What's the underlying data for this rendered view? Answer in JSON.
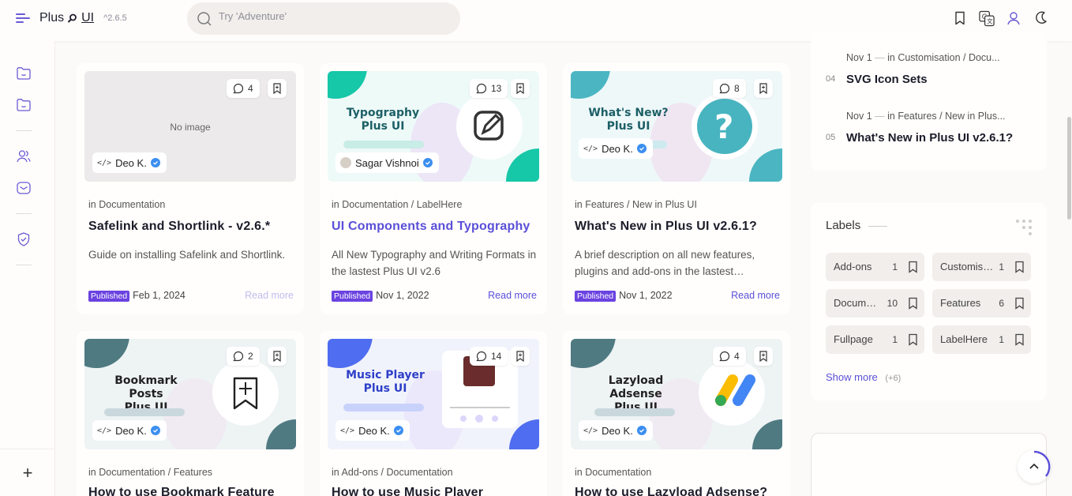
{
  "header": {
    "logo_text": "Plus",
    "logo_ui": "UI",
    "version": "^2.6.5",
    "search_placeholder": "Try 'Adventure'",
    "icons": [
      "bookmark-icon",
      "translate-icon",
      "user-icon",
      "moon-icon"
    ]
  },
  "sidebar": {
    "icons": [
      "folder-smile-icon",
      "folder-smile-icon",
      "users-icon",
      "mail-icon",
      "shield-check-icon"
    ],
    "add_label": "+"
  },
  "posts": [
    {
      "comments": "4",
      "thumb_text": "No image",
      "author": "Deo K.",
      "category": "Documentation",
      "title": "Safelink and Shortlink - v2.6.*",
      "desc": "Guide on installing Safelink and Shortlink.",
      "status": "Published",
      "date": "Feb 1, 2024",
      "read_more": "Read more"
    },
    {
      "comments": "13",
      "art_title": "Typography\nPlus UI",
      "author": "Sagar Vishnoi",
      "category": "Documentation / LabelHere",
      "title": "UI Components and Typography",
      "desc": "All New Typography and Writing Formats in the lastest Plus UI v2.6",
      "status": "Published",
      "date": "Nov 1, 2022",
      "read_more": "Read more"
    },
    {
      "comments": "8",
      "art_title": "What's New?\nPlus UI",
      "author": "Deo K.",
      "category": "Features / New in Plus UI",
      "title": "What's New in Plus UI v2.6.1?",
      "desc": "A brief description on all new features, plugins and add-ons in the lastest…",
      "status": "Published",
      "date": "Nov 1, 2022",
      "read_more": "Read more"
    },
    {
      "comments": "2",
      "art_title": "Bookmark Posts\nPlus UI",
      "author": "Deo K.",
      "category": "Documentation / Features",
      "title": "How to use Bookmark Feature"
    },
    {
      "comments": "14",
      "art_title": "Music Player\nPlus UI",
      "author": "Deo K.",
      "category": "Add-ons / Documentation",
      "title": "How to use Music Player"
    },
    {
      "comments": "4",
      "art_title": "Lazyload Adsense\nPlus UI",
      "author": "Deo K.",
      "category": "Documentation",
      "title": "How to use Lazyload Adsense?"
    }
  ],
  "popular": [
    {
      "num": "04",
      "date": "Nov 1",
      "cat": "in Customisation / Docu...",
      "title": "SVG Icon Sets"
    },
    {
      "num": "05",
      "date": "Nov 1",
      "cat": "in Features / New in Plus...",
      "title": "What's New in Plus UI v2.6.1?"
    }
  ],
  "labels_widget": {
    "heading": "Labels",
    "items": [
      {
        "name": "Add-ons",
        "count": "1"
      },
      {
        "name": "Customisation",
        "count": "1"
      },
      {
        "name": "Documentation",
        "count": "10"
      },
      {
        "name": "Features",
        "count": "6"
      },
      {
        "name": "Fullpage",
        "count": "1"
      },
      {
        "name": "LabelHere",
        "count": "1"
      }
    ],
    "show_more": "Show more",
    "more_count": "(+6)"
  },
  "prefix_in": "in",
  "colors": {
    "accent": "#5a4fd8",
    "published": "#6a43e0",
    "teal": "#1c5f66"
  }
}
